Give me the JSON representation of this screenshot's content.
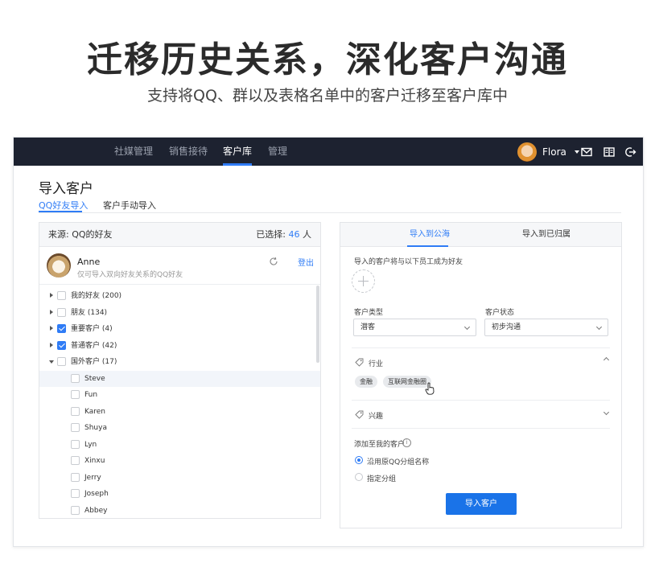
{
  "hero": {
    "title": "迁移历史关系，深化客户沟通",
    "subtitle": "支持将QQ、群以及表格名单中的客户迁移至客户库中"
  },
  "topbar": {
    "nav": [
      "社媒管理",
      "销售接待",
      "客户库",
      "管理"
    ],
    "active_nav": "客户库",
    "user_name": "Flora",
    "icons": [
      "mail-icon",
      "book-icon",
      "logout-icon"
    ]
  },
  "page": {
    "title": "导入客户",
    "tabs": [
      "QQ好友导入",
      "客户手动导入"
    ],
    "active_tab": "QQ好友导入"
  },
  "source_panel": {
    "source_label": "来源: QQ的好友",
    "selected_prefix": "已选择: ",
    "selected_count": "46",
    "selected_suffix": " 人",
    "profile": {
      "name": "Anne",
      "hint": "仅可导入双向好友关系的QQ好友",
      "logout": "登出"
    },
    "tree": [
      {
        "label": "我的好友 (200)",
        "level": 0,
        "checked": false,
        "expanded": false
      },
      {
        "label": "朋友 (134)",
        "level": 0,
        "checked": false,
        "expanded": false
      },
      {
        "label": "重要客户 (4)",
        "level": 0,
        "checked": true,
        "expanded": false
      },
      {
        "label": "普通客户 (42)",
        "level": 0,
        "checked": true,
        "expanded": false
      },
      {
        "label": "国外客户 (17)",
        "level": 0,
        "checked": false,
        "expanded": true
      },
      {
        "label": "Steve",
        "level": 1,
        "checked": false,
        "highlight": true
      },
      {
        "label": "Fun",
        "level": 1,
        "checked": false
      },
      {
        "label": "Karen",
        "level": 1,
        "checked": false
      },
      {
        "label": "Shuya",
        "level": 1,
        "checked": false
      },
      {
        "label": "Lyn",
        "level": 1,
        "checked": false
      },
      {
        "label": "Xinxu",
        "level": 1,
        "checked": false
      },
      {
        "label": "Jerry",
        "level": 1,
        "checked": false
      },
      {
        "label": "Joseph",
        "level": 1,
        "checked": false
      },
      {
        "label": "Abbey",
        "level": 1,
        "checked": false
      }
    ]
  },
  "target_panel": {
    "tabs": [
      "导入到公海",
      "导入到已归属"
    ],
    "active_tab": "导入到公海",
    "friend_hint": "导入的客户将与以下员工成为好友",
    "type_label": "客户类型",
    "type_value": "潜客",
    "status_label": "客户状态",
    "status_value": "初步沟通",
    "industry_label": "行业",
    "industry_tags": [
      "金融",
      "互联网金融圈"
    ],
    "interest_label": "兴趣",
    "add_label": "添加至我的客户",
    "info_glyph": "i",
    "options": [
      "沿用原QQ分组名称",
      "指定分组"
    ],
    "selected_option": "沿用原QQ分组名称",
    "import_button": "导入客户"
  },
  "colors": {
    "topbar": "#1d2230",
    "accent": "#2f7cf6",
    "button": "#1a73e8"
  }
}
